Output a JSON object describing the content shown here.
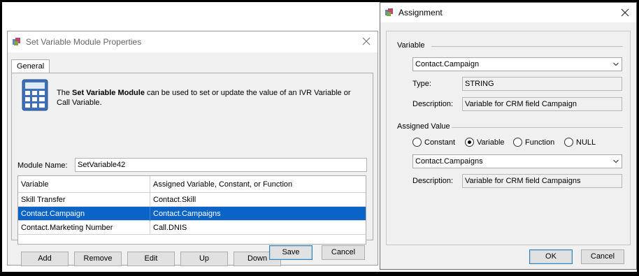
{
  "left_dialog": {
    "title": "Set Variable Module Properties",
    "tab_general": "General",
    "description_prefix": "The ",
    "description_bold": "Set Variable Module",
    "description_rest": " can be used to set or update the value of an IVR Variable or Call Variable.",
    "module_name_label": "Module Name:",
    "module_name_value": "SetVariable42",
    "table": {
      "headers": [
        "Variable",
        "Assigned Variable, Constant, or Function"
      ],
      "rows": [
        {
          "variable": "Skill Transfer",
          "assigned": "Contact.Skill",
          "selected": false
        },
        {
          "variable": "Contact.Campaign",
          "assigned": "Contact.Campaigns",
          "selected": true
        },
        {
          "variable": "Contact.Marketing Number",
          "assigned": "Call.DNIS",
          "selected": false
        }
      ]
    },
    "buttons": {
      "add": "Add",
      "remove": "Remove",
      "edit": "Edit",
      "up": "Up",
      "down": "Down",
      "save": "Save",
      "cancel": "Cancel"
    }
  },
  "right_dialog": {
    "title": "Assignment",
    "variable_section": "Variable",
    "variable_value": "Contact.Campaign",
    "type_label": "Type:",
    "type_value": "STRING",
    "description_label": "Description:",
    "description_value": "Variable for CRM field Campaign",
    "assigned_section": "Assigned Value",
    "radio_options": {
      "constant": "Constant",
      "variable": "Variable",
      "function": "Function",
      "null": "NULL"
    },
    "radio_selected": "variable",
    "assigned_value": "Contact.Campaigns",
    "assigned_description_label": "Description:",
    "assigned_description_value": "Variable for CRM field Campaigns",
    "buttons": {
      "ok": "OK",
      "cancel": "Cancel"
    }
  },
  "icons": [
    "app-icon",
    "close-icon",
    "calculator-icon",
    "chevron-down-icon"
  ],
  "colors": {
    "selection": "#0a64c8",
    "dialog_bg": "#f0f0f0",
    "primary_border": "#3c7fb1"
  }
}
